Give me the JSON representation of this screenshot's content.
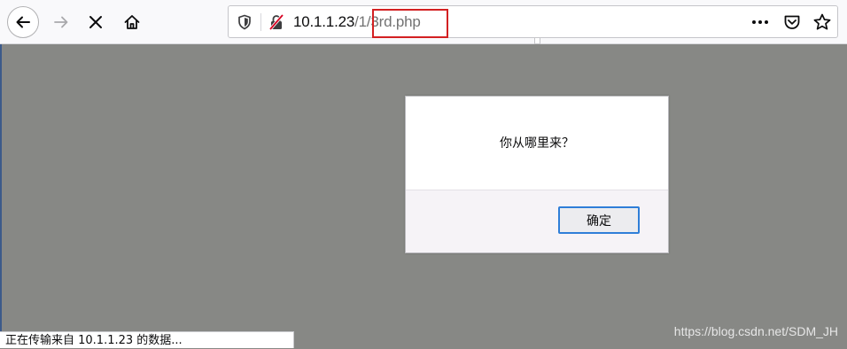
{
  "toolbar": {
    "url_host": "10.1.1.23",
    "url_path_prefix": "/1/",
    "url_path_file": "3rd.php"
  },
  "dialog": {
    "message": "你从哪里来？",
    "ok_label": "确定"
  },
  "status": {
    "text": "正在传输来自 10.1.1.23 的数据..."
  },
  "watermark": {
    "text": "https://blog.csdn.net/SDM_JH"
  },
  "colors": {
    "backdrop": "#878885",
    "highlight_box": "#d32022",
    "button_focus": "#2f7ed8"
  },
  "icons": [
    "back-arrow-icon",
    "forward-arrow-icon",
    "stop-icon",
    "home-icon",
    "shield-icon",
    "insecure-lock-icon",
    "more-dots-icon",
    "pocket-icon",
    "star-icon"
  ]
}
